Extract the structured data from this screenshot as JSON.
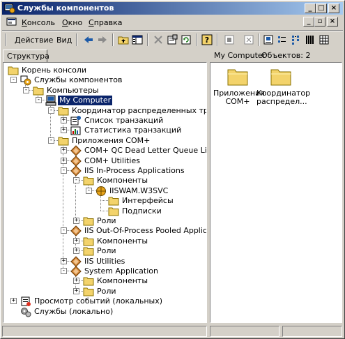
{
  "window": {
    "title": "Службы компонентов"
  },
  "title_buttons": {
    "minimize": "_",
    "maximize": "□",
    "close": "×"
  },
  "menu": {
    "items": [
      {
        "mnemonic": "К",
        "rest": "онсоль"
      },
      {
        "mnemonic": "О",
        "rest": "кно"
      },
      {
        "mnemonic": "С",
        "rest": "правка"
      }
    ]
  },
  "mdi_buttons": {
    "minimize": "_",
    "restore": "▫",
    "close": "×"
  },
  "toolbar": {
    "action_label": "Действие",
    "view_label": "Вид"
  },
  "left_tab": {
    "label": "Структура"
  },
  "right_header": {
    "location": "My Computer",
    "objects": "Объектов: 2"
  },
  "tree": [
    {
      "label": "Корень консоли",
      "icon": "folder-icon"
    },
    {
      "label": "Службы компонентов",
      "icon": "component-services-icon"
    },
    {
      "label": "Компьютеры",
      "icon": "folder-icon"
    },
    {
      "label": "My Computer",
      "icon": "computer-icon",
      "selected": true
    },
    {
      "label": "Координатор распределенных транзакций",
      "icon": "folder-icon"
    },
    {
      "label": "Список транзакций",
      "icon": "transaction-list-icon"
    },
    {
      "label": "Статистика транзакций",
      "icon": "transaction-stats-icon"
    },
    {
      "label": "Приложения COM+",
      "icon": "folder-icon"
    },
    {
      "label": "COM+ QC Dead Letter Queue Listener",
      "icon": "com-app-icon"
    },
    {
      "label": "COM+ Utilities",
      "icon": "com-app-icon"
    },
    {
      "label": "IIS In-Process Applications",
      "icon": "com-app-icon"
    },
    {
      "label": "Компоненты",
      "icon": "folder-icon"
    },
    {
      "label": "IISWAM.W3SVC",
      "icon": "component-icon"
    },
    {
      "label": "Интерфейсы",
      "icon": "folder-icon"
    },
    {
      "label": "Подписки",
      "icon": "folder-icon"
    },
    {
      "label": "Роли",
      "icon": "folder-icon"
    },
    {
      "label": "IIS Out-Of-Process Pooled Applications",
      "icon": "com-app-icon"
    },
    {
      "label": "Компоненты",
      "icon": "folder-icon"
    },
    {
      "label": "Роли",
      "icon": "folder-icon"
    },
    {
      "label": "IIS Utilities",
      "icon": "com-app-icon"
    },
    {
      "label": "System Application",
      "icon": "com-app-icon"
    },
    {
      "label": "Компоненты",
      "icon": "folder-icon"
    },
    {
      "label": "Роли",
      "icon": "folder-icon"
    },
    {
      "label": "Просмотр событий (локальных)",
      "icon": "event-viewer-icon"
    },
    {
      "label": "Службы (локально)",
      "icon": "services-icon"
    }
  ],
  "right_items": [
    {
      "line1": "Приложения",
      "line2": "COM+",
      "icon": "folder-icon"
    },
    {
      "line1": "Координатор",
      "line2": "распредел...",
      "icon": "folder-icon"
    }
  ]
}
